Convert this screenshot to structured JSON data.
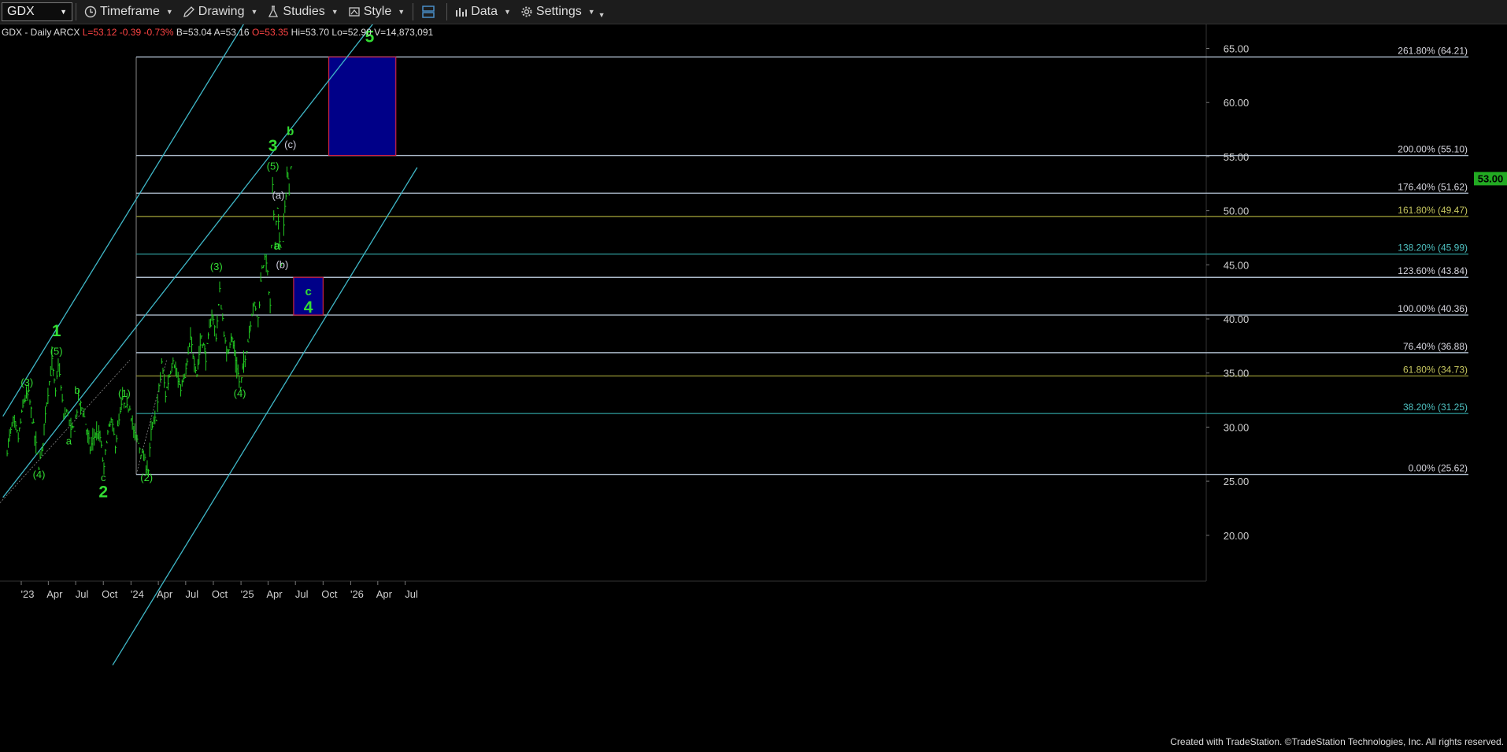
{
  "toolbar": {
    "symbol": "GDX",
    "timeframe": "Timeframe",
    "drawing": "Drawing",
    "studies": "Studies",
    "style": "Style",
    "data": "Data",
    "settings": "Settings"
  },
  "info": {
    "title": "GDX - Daily  ARCX",
    "last": "L=53.12",
    "chg": "-0.39",
    "pct": "-0.73%",
    "bid": "B=53.04",
    "ask": "A=53.16",
    "open": "O=53.35",
    "high": "Hi=53.70",
    "low": "Lo=52.90",
    "volume": "V=14,873,091"
  },
  "price_badge": "53.00",
  "footer": "Created with TradeStation. ©TradeStation Technologies, Inc. All rights reserved.",
  "colors": {
    "bars": "#22cc22",
    "channel": "#3fb8c8",
    "fib_white": "#aab8c8",
    "fib_olive": "#8a8a30",
    "fib_teal": "#2a8c8c",
    "target_fill": "#000088",
    "target_border": "#cc2244",
    "wave_label": "#33dd33",
    "aux_label": "#ccccdd"
  },
  "chart_data": {
    "type": "ohlc",
    "symbol": "GDX",
    "interval": "Daily",
    "y_ticks": [
      "65.00",
      "60.00",
      "55.00",
      "50.00",
      "45.00",
      "40.00",
      "35.00",
      "30.00",
      "25.00",
      "20.00"
    ],
    "x_ticks": [
      "'23",
      "Apr",
      "Jul",
      "Oct",
      "'24",
      "Apr",
      "Jul",
      "Oct",
      "'25",
      "Apr",
      "Jul",
      "Oct",
      "'26",
      "Apr",
      "Jul"
    ],
    "fib_levels": [
      {
        "label": "261.80% (64.21)",
        "value": 64.21,
        "style": "white"
      },
      {
        "label": "200.00% (55.10)",
        "value": 55.1,
        "style": "white"
      },
      {
        "label": "176.40% (51.62)",
        "value": 51.62,
        "style": "white"
      },
      {
        "label": "161.80% (49.47)",
        "value": 49.47,
        "style": "olive"
      },
      {
        "label": "138.20% (45.99)",
        "value": 45.99,
        "style": "teal"
      },
      {
        "label": "123.60% (43.84)",
        "value": 43.84,
        "style": "white"
      },
      {
        "label": "100.00% (40.36)",
        "value": 40.36,
        "style": "white"
      },
      {
        "label": "76.40% (36.88)",
        "value": 36.88,
        "style": "white"
      },
      {
        "label": "61.80% (34.73)",
        "value": 34.73,
        "style": "olive"
      },
      {
        "label": "38.20% (31.25)",
        "value": 31.25,
        "style": "teal"
      },
      {
        "label": "0.00% (25.62)",
        "value": 25.62,
        "style": "white"
      }
    ],
    "close_path": [
      [
        "2022-11-15",
        28.0
      ],
      [
        "2022-12-05",
        30.5
      ],
      [
        "2022-12-22",
        29.0
      ],
      [
        "2023-01-10",
        32.5
      ],
      [
        "2023-01-26",
        33.0
      ],
      [
        "2023-02-10",
        30.0
      ],
      [
        "2023-02-28",
        26.5
      ],
      [
        "2023-03-10",
        27.5
      ],
      [
        "2023-03-22",
        31.5
      ],
      [
        "2023-04-13",
        36.0
      ],
      [
        "2023-04-25",
        33.0
      ],
      [
        "2023-05-04",
        36.0
      ],
      [
        "2023-05-22",
        31.0
      ],
      [
        "2023-06-05",
        31.5
      ],
      [
        "2023-06-15",
        29.5
      ],
      [
        "2023-06-26",
        30.0
      ],
      [
        "2023-07-10",
        32.5
      ],
      [
        "2023-07-25",
        31.5
      ],
      [
        "2023-08-18",
        28.0
      ],
      [
        "2023-09-05",
        29.5
      ],
      [
        "2023-09-20",
        29.0
      ],
      [
        "2023-10-03",
        26.0
      ],
      [
        "2023-10-12",
        29.0
      ],
      [
        "2023-10-27",
        30.5
      ],
      [
        "2023-11-10",
        28.5
      ],
      [
        "2023-11-22",
        30.5
      ],
      [
        "2023-12-04",
        32.5
      ],
      [
        "2023-12-14",
        31.5
      ],
      [
        "2023-12-28",
        32.0
      ],
      [
        "2024-01-10",
        29.5
      ],
      [
        "2024-01-25",
        28.5
      ],
      [
        "2024-02-12",
        27.0
      ],
      [
        "2024-02-28",
        26.0
      ],
      [
        "2024-03-08",
        29.5
      ],
      [
        "2024-03-25",
        31.0
      ],
      [
        "2024-04-12",
        36.0
      ],
      [
        "2024-04-25",
        33.0
      ],
      [
        "2024-05-20",
        36.5
      ],
      [
        "2024-06-10",
        33.5
      ],
      [
        "2024-06-28",
        34.5
      ],
      [
        "2024-07-17",
        38.0
      ],
      [
        "2024-08-07",
        35.0
      ],
      [
        "2024-08-22",
        38.5
      ],
      [
        "2024-09-06",
        36.5
      ],
      [
        "2024-09-26",
        40.5
      ],
      [
        "2024-10-10",
        38.5
      ],
      [
        "2024-10-22",
        42.5
      ],
      [
        "2024-11-01",
        40.0
      ],
      [
        "2024-11-14",
        36.5
      ],
      [
        "2024-11-29",
        38.5
      ],
      [
        "2024-12-10",
        37.0
      ],
      [
        "2024-12-30",
        33.5
      ],
      [
        "2025-01-10",
        36.0
      ],
      [
        "2025-01-24",
        38.0
      ],
      [
        "2025-02-10",
        41.5
      ],
      [
        "2025-02-27",
        40.0
      ],
      [
        "2025-03-12",
        45.0
      ],
      [
        "2025-03-26",
        45.5
      ],
      [
        "2025-04-08",
        41.0
      ],
      [
        "2025-04-16",
        52.0
      ],
      [
        "2025-04-24",
        47.5
      ],
      [
        "2025-05-02",
        50.5
      ],
      [
        "2025-05-09",
        47.0
      ],
      [
        "2025-05-16",
        45.5
      ],
      [
        "2025-05-27",
        50.0
      ],
      [
        "2025-06-03",
        53.5
      ],
      [
        "2025-06-10",
        52.0
      ],
      [
        "2025-06-16",
        54.5
      ],
      [
        "2025-06-20",
        53.0
      ]
    ],
    "channel_lines": [
      {
        "from": [
          "2022-11-01",
          31.0
        ],
        "to": [
          "2026-01-15",
          84.0
        ]
      },
      {
        "from": [
          "2022-11-01",
          23.5
        ],
        "to": [
          "2026-08-10",
          72.5
        ]
      },
      {
        "from": [
          "2023-11-01",
          8.0
        ],
        "to": [
          "2026-08-10",
          54.0
        ]
      }
    ],
    "target_boxes": [
      {
        "from": "2025-10-20",
        "to": "2026-05-31",
        "low": 55.1,
        "high": 64.21
      },
      {
        "from": "2025-06-25",
        "to": "2025-10-01",
        "low": 40.36,
        "high": 43.84
      }
    ],
    "wave_labels": [
      {
        "text": "(3)",
        "date": "2023-01-20",
        "value": 33.8,
        "kind": "minor"
      },
      {
        "text": "(4)",
        "date": "2023-03-01",
        "value": 25.3,
        "kind": "minor"
      },
      {
        "text": "1",
        "date": "2023-04-28",
        "value": 38.4,
        "kind": "major"
      },
      {
        "text": "(5)",
        "date": "2023-04-28",
        "value": 36.7,
        "kind": "minor"
      },
      {
        "text": "b",
        "date": "2023-07-06",
        "value": 33.1,
        "kind": "minor"
      },
      {
        "text": "a",
        "date": "2023-06-08",
        "value": 28.4,
        "kind": "minor"
      },
      {
        "text": "c",
        "date": "2023-10-01",
        "value": 25.0,
        "kind": "minor"
      },
      {
        "text": "2",
        "date": "2023-10-01",
        "value": 23.5,
        "kind": "major"
      },
      {
        "text": "(1)",
        "date": "2023-12-10",
        "value": 32.8,
        "kind": "minor"
      },
      {
        "text": "(2)",
        "date": "2024-02-22",
        "value": 25.0,
        "kind": "minor"
      },
      {
        "text": "(3)",
        "date": "2024-10-11",
        "value": 44.5,
        "kind": "minor"
      },
      {
        "text": "(4)",
        "date": "2024-12-28",
        "value": 32.8,
        "kind": "minor"
      },
      {
        "text": "3",
        "date": "2025-04-17",
        "value": 55.5,
        "kind": "major"
      },
      {
        "text": "(5)",
        "date": "2025-04-17",
        "value": 53.8,
        "kind": "minor"
      },
      {
        "text": "(a)",
        "date": "2025-05-05",
        "value": 51.1,
        "kind": "aux"
      },
      {
        "text": "a",
        "date": "2025-05-01",
        "value": 46.4,
        "kind": "minor-bold"
      },
      {
        "text": "(b)",
        "date": "2025-05-18",
        "value": 44.7,
        "kind": "aux"
      },
      {
        "text": "b",
        "date": "2025-06-14",
        "value": 57.0,
        "kind": "minor-bold"
      },
      {
        "text": "(c)",
        "date": "2025-06-14",
        "value": 55.8,
        "kind": "aux"
      },
      {
        "text": "5",
        "date": "2026-03-05",
        "value": 65.6,
        "kind": "major"
      },
      {
        "text": "c",
        "date": "2025-08-13",
        "value": 42.2,
        "kind": "minor-bold"
      },
      {
        "text": "4",
        "date": "2025-08-13",
        "value": 40.6,
        "kind": "major"
      }
    ]
  }
}
